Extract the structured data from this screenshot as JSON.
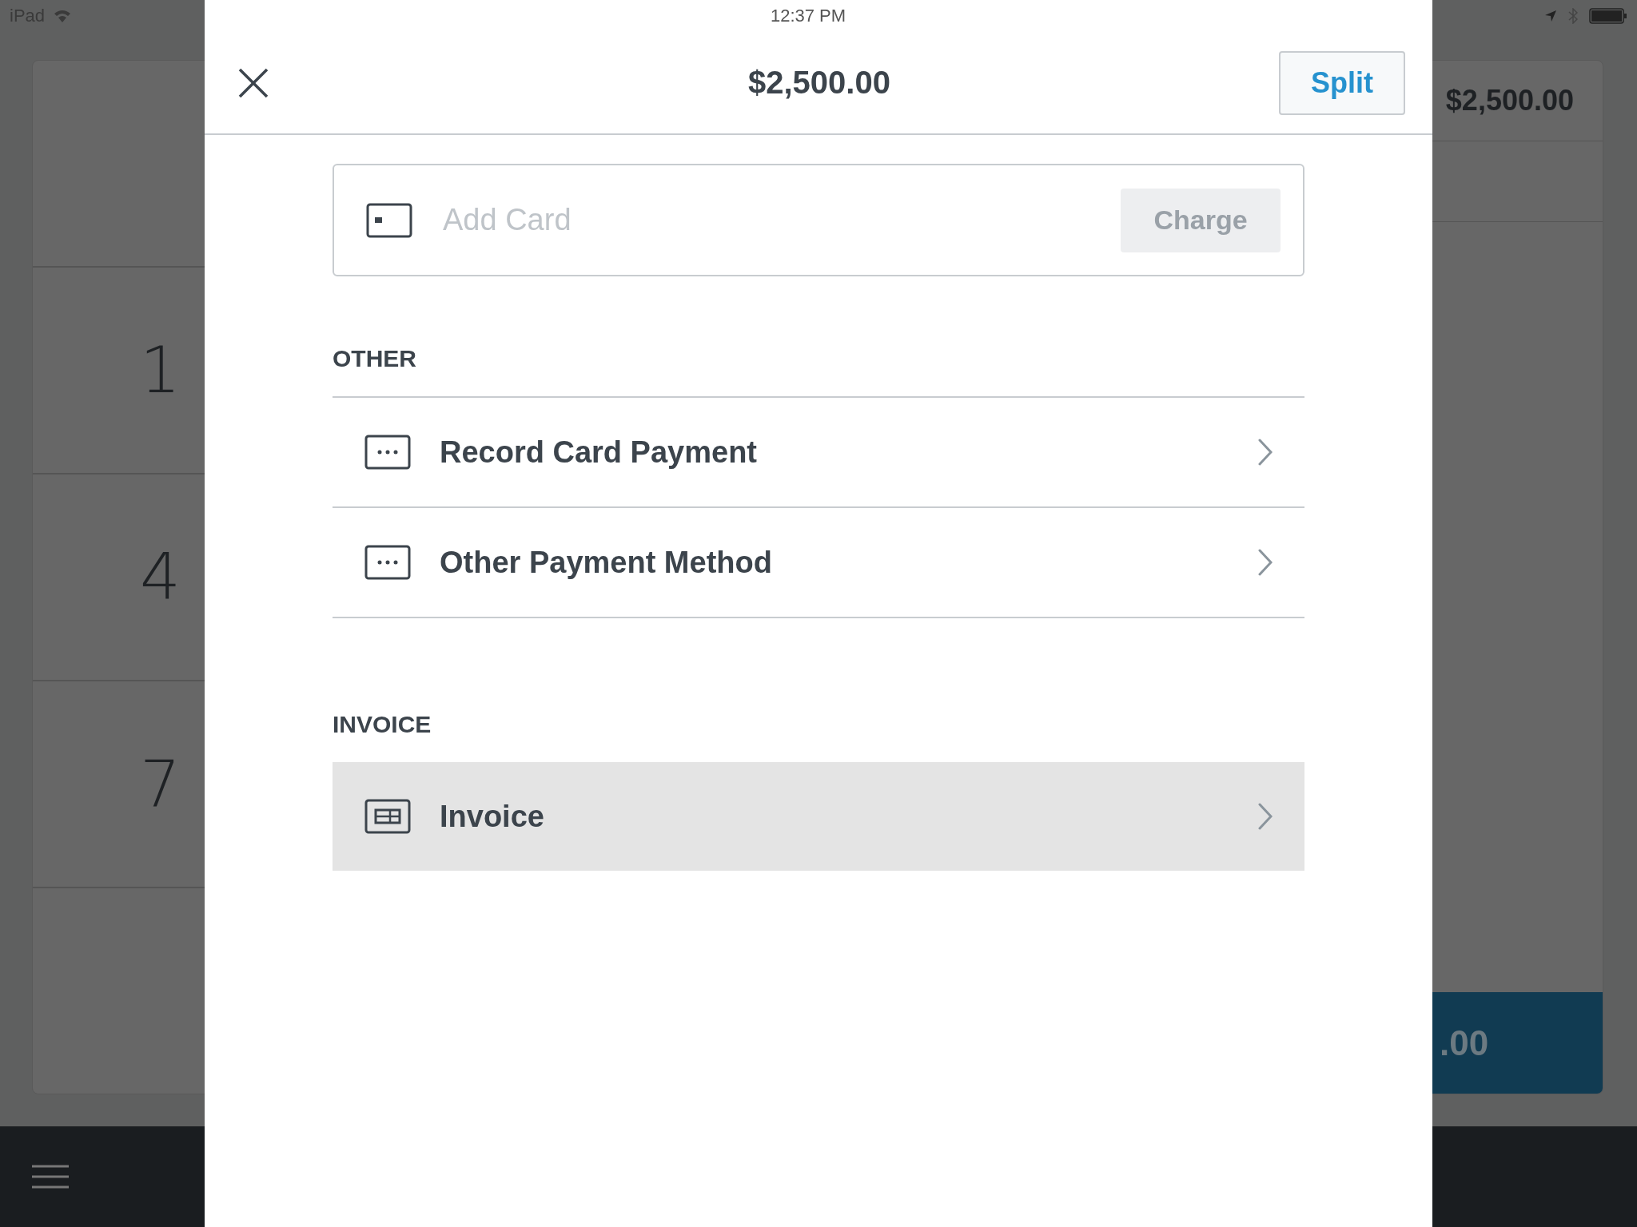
{
  "status_bar": {
    "carrier": "iPad",
    "time": "12:37 PM"
  },
  "background": {
    "keypad": [
      "1",
      "4",
      "7"
    ],
    "sale_total": "$2,500.00",
    "charge_amount": ".00"
  },
  "modal": {
    "amount": "$2,500.00",
    "split_button": "Split",
    "card_field": {
      "placeholder": "Add Card"
    },
    "charge_button": {
      "label": "Charge",
      "disabled": true
    },
    "sections": [
      {
        "title": "OTHER",
        "items": [
          {
            "label": "Record Card Payment",
            "kind": "dots",
            "selected": false
          },
          {
            "label": "Other Payment Method",
            "kind": "dots",
            "selected": false
          }
        ]
      },
      {
        "title": "INVOICE",
        "items": [
          {
            "label": "Invoice",
            "kind": "invoice",
            "selected": true
          }
        ]
      }
    ]
  }
}
